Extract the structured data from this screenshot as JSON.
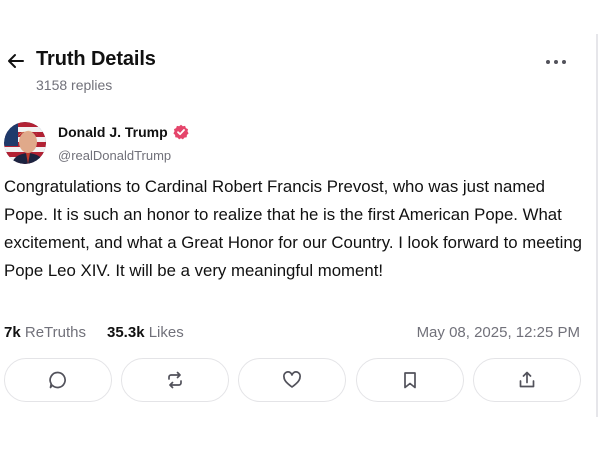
{
  "header": {
    "title": "Truth Details",
    "replies": "3158 replies",
    "back_icon": "arrow-left-icon",
    "more_icon": "more-horizontal-icon"
  },
  "author": {
    "name": "Donald J. Trump",
    "handle": "@realDonaldTrump",
    "verified": true,
    "verified_color": "#e5456b"
  },
  "post": {
    "text": "Congratulations to Cardinal Robert Francis Prevost, who was just named Pope. It is such an honor to realize that he is the first American Pope. What excitement, and what a Great Honor for our Country. I look forward to meeting Pope Leo XIV. It will be a very meaningful moment!"
  },
  "stats": {
    "retruths_count": "7k",
    "retruths_label": "ReTruths",
    "likes_count": "35.3k",
    "likes_label": "Likes",
    "timestamp": "May 08, 2025, 12:25 PM"
  },
  "actions": [
    {
      "name": "reply",
      "icon": "comment-icon"
    },
    {
      "name": "retruth",
      "icon": "repost-icon"
    },
    {
      "name": "like",
      "icon": "heart-icon"
    },
    {
      "name": "bookmark",
      "icon": "bookmark-icon"
    },
    {
      "name": "share",
      "icon": "share-icon"
    }
  ],
  "colors": {
    "text": "#111111",
    "muted": "#71717a",
    "border": "#e4e4e7",
    "icon": "#52525b"
  }
}
